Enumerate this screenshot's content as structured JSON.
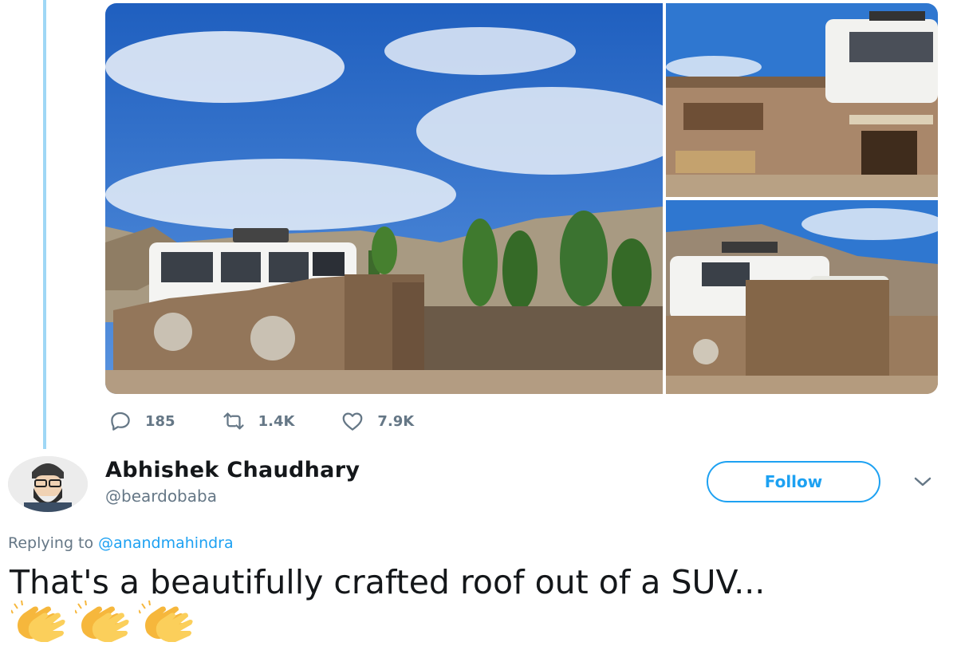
{
  "media": {
    "main_alt": "photo-main",
    "top_right_alt": "photo-top-right",
    "bottom_right_alt": "photo-bottom-right"
  },
  "actions": {
    "reply_count": "185",
    "retweet_count": "1.4K",
    "like_count": "7.9K"
  },
  "user": {
    "name": "Abhishek Chaudhary",
    "handle": "@beardobaba"
  },
  "follow_label": "Follow",
  "reply_context": {
    "prefix": "Replying to",
    "mention": "@anandmahindra"
  },
  "tweet_text": "That's a beautifully crafted roof out of a SUV...",
  "emojis": [
    "clapping-hands-emoji",
    "clapping-hands-emoji",
    "clapping-hands-emoji"
  ],
  "colors": {
    "accent": "#1da1f2",
    "muted": "#657786",
    "thread_line": "#9fd7f5"
  }
}
